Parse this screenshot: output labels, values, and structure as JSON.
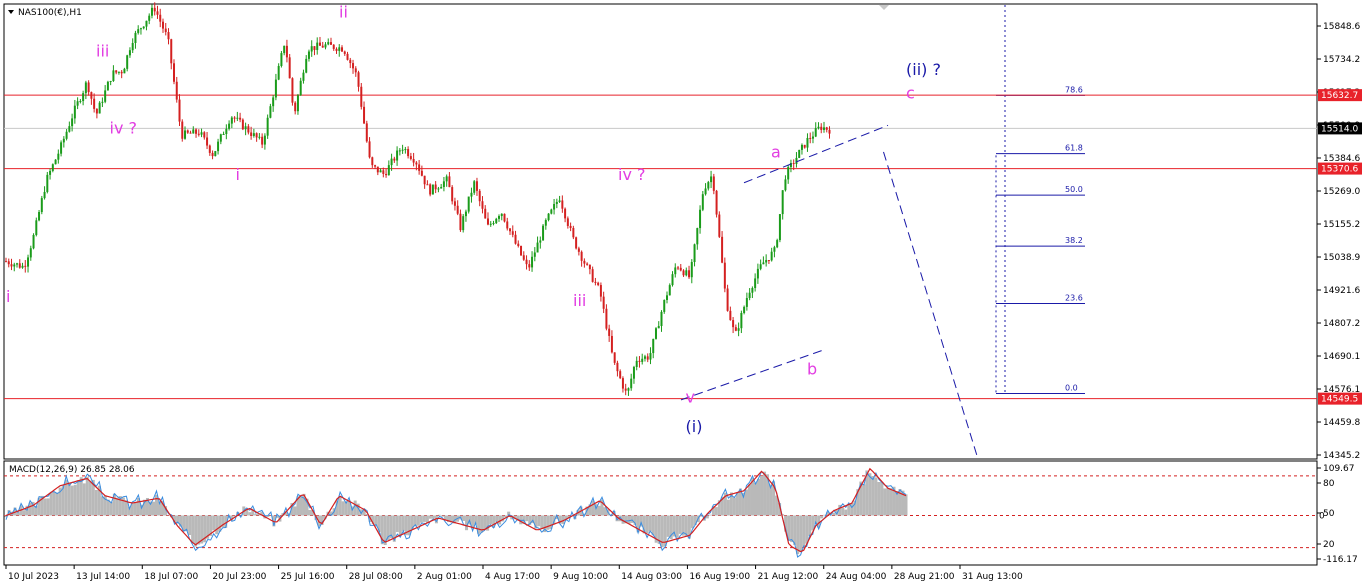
{
  "chart_data": [
    {
      "type": "candlestick",
      "title": "NAS100(€),H1",
      "x_labels": [
        "10 Jul 2023",
        "13 Jul 14:00",
        "18 Jul 07:00",
        "20 Jul 23:00",
        "25 Jul 16:00",
        "28 Jul 08:00",
        "2 Aug 01:00",
        "4 Aug 17:00",
        "9 Aug 10:00",
        "14 Aug 03:00",
        "16 Aug 19:00",
        "21 Aug 12:00",
        "24 Aug 04:00",
        "28 Aug 21:00",
        "31 Aug 13:00"
      ],
      "y_ticks": [
        "15848.6",
        "15734.2",
        "15617.2",
        "15500.9",
        "15384.6",
        "15269.0",
        "15155.2",
        "15038.9",
        "14921.6",
        "14807.2",
        "14690.1",
        "14576.1",
        "14459.8",
        "14345.2"
      ],
      "ylim": [
        14334,
        15958
      ],
      "price_tags": [
        {
          "label": "15632.7",
          "value": 15632.7,
          "color": "#e8222a"
        },
        {
          "label": "15514.0",
          "value": 15514.0,
          "color": "#000000"
        },
        {
          "label": "15370.6",
          "value": 15370.6,
          "color": "#e8222a"
        },
        {
          "label": "14549.5",
          "value": 14549.5,
          "color": "#e8222a"
        }
      ],
      "horizontal_lines": [
        15632.7,
        15370.6,
        14549.5
      ],
      "fibonacci": [
        {
          "label": "78.6",
          "value": 15632
        },
        {
          "label": "61.8",
          "value": 15424
        },
        {
          "label": "50.0",
          "value": 15276
        },
        {
          "label": "38.2",
          "value": 15094
        },
        {
          "label": "23.6",
          "value": 14889
        },
        {
          "label": "0.0",
          "value": 14568
        }
      ],
      "waypoints": [
        {
          "x": 0.0,
          "y": 15040
        },
        {
          "x": 0.02,
          "y": 15020
        },
        {
          "x": 0.03,
          "y": 15120
        },
        {
          "x": 0.045,
          "y": 15330
        },
        {
          "x": 0.06,
          "y": 15440
        },
        {
          "x": 0.075,
          "y": 15570
        },
        {
          "x": 0.09,
          "y": 15680
        },
        {
          "x": 0.1,
          "y": 15560
        },
        {
          "x": 0.118,
          "y": 15710
        },
        {
          "x": 0.13,
          "y": 15720
        },
        {
          "x": 0.14,
          "y": 15830
        },
        {
          "x": 0.165,
          "y": 15945
        },
        {
          "x": 0.18,
          "y": 15830
        },
        {
          "x": 0.195,
          "y": 15490
        },
        {
          "x": 0.215,
          "y": 15500
        },
        {
          "x": 0.23,
          "y": 15420
        },
        {
          "x": 0.25,
          "y": 15560
        },
        {
          "x": 0.268,
          "y": 15510
        },
        {
          "x": 0.285,
          "y": 15460
        },
        {
          "x": 0.31,
          "y": 15830
        },
        {
          "x": 0.32,
          "y": 15560
        },
        {
          "x": 0.335,
          "y": 15800
        },
        {
          "x": 0.355,
          "y": 15810
        },
        {
          "x": 0.375,
          "y": 15800
        },
        {
          "x": 0.39,
          "y": 15700
        },
        {
          "x": 0.405,
          "y": 15380
        },
        {
          "x": 0.42,
          "y": 15350
        },
        {
          "x": 0.44,
          "y": 15450
        },
        {
          "x": 0.455,
          "y": 15400
        },
        {
          "x": 0.47,
          "y": 15290
        },
        {
          "x": 0.49,
          "y": 15330
        },
        {
          "x": 0.505,
          "y": 15160
        },
        {
          "x": 0.52,
          "y": 15320
        },
        {
          "x": 0.535,
          "y": 15160
        },
        {
          "x": 0.55,
          "y": 15220
        },
        {
          "x": 0.565,
          "y": 15110
        },
        {
          "x": 0.58,
          "y": 15010
        },
        {
          "x": 0.6,
          "y": 15180
        },
        {
          "x": 0.615,
          "y": 15270
        },
        {
          "x": 0.63,
          "y": 15120
        },
        {
          "x": 0.645,
          "y": 15020
        },
        {
          "x": 0.66,
          "y": 14930
        },
        {
          "x": 0.675,
          "y": 14680
        },
        {
          "x": 0.69,
          "y": 14560
        },
        {
          "x": 0.7,
          "y": 14690
        },
        {
          "x": 0.715,
          "y": 14700
        },
        {
          "x": 0.73,
          "y": 14880
        },
        {
          "x": 0.745,
          "y": 15030
        },
        {
          "x": 0.76,
          "y": 14980
        },
        {
          "x": 0.775,
          "y": 15300
        },
        {
          "x": 0.785,
          "y": 15350
        },
        {
          "x": 0.8,
          "y": 14900
        },
        {
          "x": 0.81,
          "y": 14770
        },
        {
          "x": 0.825,
          "y": 14930
        },
        {
          "x": 0.84,
          "y": 15030
        },
        {
          "x": 0.855,
          "y": 15080
        },
        {
          "x": 0.865,
          "y": 15340
        },
        {
          "x": 0.88,
          "y": 15420
        },
        {
          "x": 0.89,
          "y": 15470
        },
        {
          "x": 0.905,
          "y": 15520
        },
        {
          "x": 0.915,
          "y": 15510
        }
      ],
      "wave_labels": [
        {
          "text": "i",
          "value": 14895,
          "pos": 0.0,
          "color": "#e23de2"
        },
        {
          "text": "iii",
          "value": 15770,
          "pos": 0.1,
          "color": "#e23de2"
        },
        {
          "text": "iv ?",
          "value": 15495,
          "pos": 0.115,
          "color": "#e23de2"
        },
        {
          "text": "ii",
          "value": 15910,
          "pos": 0.37,
          "color": "#e23de2"
        },
        {
          "text": "i",
          "value": 15330,
          "pos": 0.255,
          "color": "#e23de2"
        },
        {
          "text": "iv ?",
          "value": 15330,
          "pos": 0.68,
          "color": "#e23de2"
        },
        {
          "text": "iii",
          "value": 14880,
          "pos": 0.63,
          "color": "#e23de2"
        },
        {
          "text": "a",
          "value": 15410,
          "pos": 0.85,
          "color": "#e23de2"
        },
        {
          "text": "b",
          "value": 14635,
          "pos": 0.89,
          "color": "#e23de2"
        },
        {
          "text": "c",
          "value": 15620,
          "pos": 1.0,
          "color": "#e23de2"
        },
        {
          "text": "v",
          "value": 14535,
          "pos": 0.755,
          "color": "#e23de2"
        },
        {
          "text": "(i)",
          "value": 14430,
          "pos": 0.755,
          "color": "#1a1aa8"
        },
        {
          "text": "(ii) ?",
          "value": 15705,
          "pos": 1.0,
          "color": "#1a1aa8"
        }
      ],
      "trend_lines": [
        {
          "from": {
            "pos": 0.82,
            "value": 15320
          },
          "to": {
            "pos": 0.98,
            "value": 15525
          }
        },
        {
          "from": {
            "pos": 0.75,
            "value": 14545
          },
          "to": {
            "pos": 0.91,
            "value": 14725
          }
        },
        {
          "from": {
            "pos": 0.975,
            "value": 15430
          },
          "to": {
            "pos": 1.08,
            "value": 14334
          }
        }
      ]
    },
    {
      "type": "histogram",
      "title": "MACD(12,26,9) 26.85 28.06",
      "y_ticks": [
        "109.67",
        "80",
        "50",
        "20",
        "-116.17"
      ],
      "extra_tick": "0",
      "levels": [
        80,
        0,
        -65
      ],
      "signal_points": [
        {
          "x": 0.0,
          "y": 0
        },
        {
          "x": 0.03,
          "y": 20
        },
        {
          "x": 0.06,
          "y": 60
        },
        {
          "x": 0.09,
          "y": 75
        },
        {
          "x": 0.11,
          "y": 40
        },
        {
          "x": 0.14,
          "y": 25
        },
        {
          "x": 0.17,
          "y": 35
        },
        {
          "x": 0.19,
          "y": -20
        },
        {
          "x": 0.21,
          "y": -60
        },
        {
          "x": 0.24,
          "y": -20
        },
        {
          "x": 0.27,
          "y": 15
        },
        {
          "x": 0.3,
          "y": -15
        },
        {
          "x": 0.33,
          "y": 45
        },
        {
          "x": 0.35,
          "y": -20
        },
        {
          "x": 0.37,
          "y": 40
        },
        {
          "x": 0.4,
          "y": 10
        },
        {
          "x": 0.42,
          "y": -55
        },
        {
          "x": 0.45,
          "y": -30
        },
        {
          "x": 0.48,
          "y": -5
        },
        {
          "x": 0.5,
          "y": -15
        },
        {
          "x": 0.53,
          "y": -30
        },
        {
          "x": 0.56,
          "y": 0
        },
        {
          "x": 0.59,
          "y": -30
        },
        {
          "x": 0.62,
          "y": -10
        },
        {
          "x": 0.66,
          "y": 30
        },
        {
          "x": 0.68,
          "y": -5
        },
        {
          "x": 0.7,
          "y": -25
        },
        {
          "x": 0.73,
          "y": -55
        },
        {
          "x": 0.76,
          "y": -40
        },
        {
          "x": 0.78,
          "y": 5
        },
        {
          "x": 0.8,
          "y": 40
        },
        {
          "x": 0.82,
          "y": 50
        },
        {
          "x": 0.84,
          "y": 90
        },
        {
          "x": 0.855,
          "y": 55
        },
        {
          "x": 0.87,
          "y": -60
        },
        {
          "x": 0.885,
          "y": -75
        },
        {
          "x": 0.9,
          "y": -20
        },
        {
          "x": 0.92,
          "y": 10
        },
        {
          "x": 0.94,
          "y": 25
        },
        {
          "x": 0.96,
          "y": 95
        },
        {
          "x": 0.98,
          "y": 55
        },
        {
          "x": 1.0,
          "y": 40
        }
      ]
    }
  ]
}
